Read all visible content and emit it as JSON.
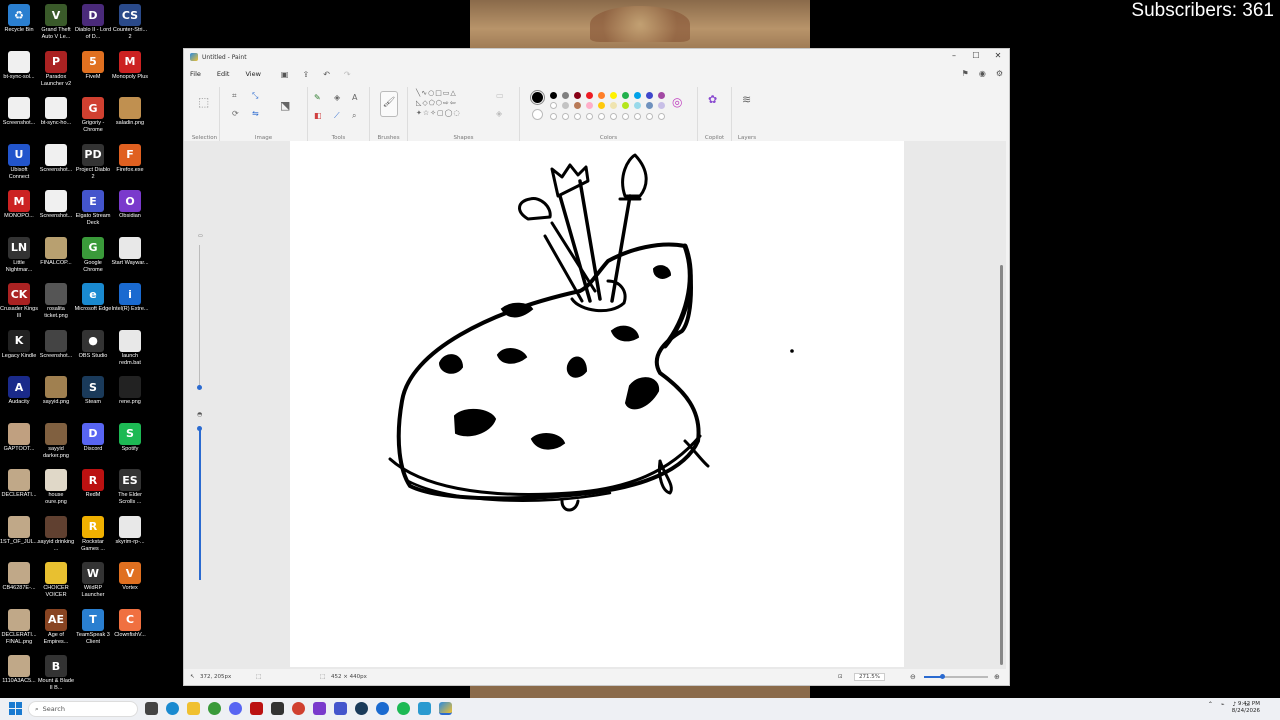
{
  "overlay": {
    "subscribers": "Subscribers: 361"
  },
  "desktop_icons": [
    {
      "label": "Recycle Bin",
      "color": "#2a7fd0",
      "glyph": "♻"
    },
    {
      "label": "Grand Theft Auto V Le...",
      "color": "#3a5a2a",
      "glyph": "V"
    },
    {
      "label": "Diablo II - Lord of D...",
      "color": "#4a2a7a",
      "glyph": "D"
    },
    {
      "label": "Counter-Stri... 2",
      "color": "#2a4a8a",
      "glyph": "CS"
    },
    {
      "label": "bt-sync-sol...",
      "color": "#f0f0f0",
      "glyph": ""
    },
    {
      "label": "Paradox Launcher v2",
      "color": "#aa2222",
      "glyph": "P"
    },
    {
      "label": "FiveM",
      "color": "#e07020",
      "glyph": "5"
    },
    {
      "label": "Monopoly Plus",
      "color": "#cc2222",
      "glyph": "M"
    },
    {
      "label": "Screenshot...",
      "color": "#f0f0f0",
      "glyph": ""
    },
    {
      "label": "bt-sync-ho...",
      "color": "#f0f0f0",
      "glyph": ""
    },
    {
      "label": "Grigoriy - Chrome",
      "color": "#d04030",
      "glyph": "G"
    },
    {
      "label": "saladin.png",
      "color": "#c09050",
      "glyph": ""
    },
    {
      "label": "Ubisoft Connect",
      "color": "#2255cc",
      "glyph": "U"
    },
    {
      "label": "Screenshot...",
      "color": "#f0f0f0",
      "glyph": ""
    },
    {
      "label": "Project Diablo 2",
      "color": "#333333",
      "glyph": "PD"
    },
    {
      "label": "Firefox.exe",
      "color": "#e06020",
      "glyph": "F"
    },
    {
      "label": "MONOPO...",
      "color": "#cc2222",
      "glyph": "M"
    },
    {
      "label": "Screenshot...",
      "color": "#f0f0f0",
      "glyph": ""
    },
    {
      "label": "Elgato Stream Deck",
      "color": "#4455cc",
      "glyph": "E"
    },
    {
      "label": "Obsidian",
      "color": "#7a3acc",
      "glyph": "O"
    },
    {
      "label": "Little Nightmar...",
      "color": "#333333",
      "glyph": "LN"
    },
    {
      "label": "FINALCOP...",
      "color": "#b8a070",
      "glyph": ""
    },
    {
      "label": "Google Chrome",
      "color": "#3a9a3a",
      "glyph": "G"
    },
    {
      "label": "Start Waywar...",
      "color": "#e8e8e8",
      "glyph": ""
    },
    {
      "label": "Crusader Kings III",
      "color": "#aa2222",
      "glyph": "CK"
    },
    {
      "label": "rosalita ticket.png",
      "color": "#555555",
      "glyph": ""
    },
    {
      "label": "Microsoft Edge",
      "color": "#1a8ad0",
      "glyph": "e"
    },
    {
      "label": "Intel(R) Extre...",
      "color": "#1a6ad0",
      "glyph": "i"
    },
    {
      "label": "Legacy Kindle",
      "color": "#222222",
      "glyph": "K"
    },
    {
      "label": "Screenshot...",
      "color": "#444444",
      "glyph": ""
    },
    {
      "label": "OBS Studio",
      "color": "#333333",
      "glyph": "●"
    },
    {
      "label": "launch redm.bat",
      "color": "#e8e8e8",
      "glyph": ""
    },
    {
      "label": "Audacity",
      "color": "#1a2a8a",
      "glyph": "A"
    },
    {
      "label": "sayyid.png",
      "color": "#a08050",
      "glyph": ""
    },
    {
      "label": "Steam",
      "color": "#1a3a5a",
      "glyph": "S"
    },
    {
      "label": "rene.png",
      "color": "#222222",
      "glyph": ""
    },
    {
      "label": "GAPTOOT...",
      "color": "#c0a080",
      "glyph": ""
    },
    {
      "label": "sayyid darker.png",
      "color": "#806040",
      "glyph": ""
    },
    {
      "label": "Discord",
      "color": "#5865f2",
      "glyph": "D"
    },
    {
      "label": "Spotify",
      "color": "#1db954",
      "glyph": "S"
    },
    {
      "label": "DECLERATI...",
      "color": "#c0a888",
      "glyph": ""
    },
    {
      "label": "house oure.png",
      "color": "#e0d8c8",
      "glyph": ""
    },
    {
      "label": "RedM",
      "color": "#bb1111",
      "glyph": "R"
    },
    {
      "label": "The Elder Scrolls ...",
      "color": "#333333",
      "glyph": "ES"
    },
    {
      "label": "1ST_OF_JUL...",
      "color": "#c0a888",
      "glyph": ""
    },
    {
      "label": "sayyid drinking ...",
      "color": "#604030",
      "glyph": ""
    },
    {
      "label": "Rockstar Games ...",
      "color": "#f0b000",
      "glyph": "R"
    },
    {
      "label": "skyrim-rp-...",
      "color": "#e8e8e8",
      "glyph": ""
    },
    {
      "label": "CB46287E-...",
      "color": "#c0a888",
      "glyph": ""
    },
    {
      "label": "CHOICER VOICER",
      "color": "#e8c030",
      "glyph": ""
    },
    {
      "label": "WildRP Launcher",
      "color": "#333333",
      "glyph": "W"
    },
    {
      "label": "Vortex",
      "color": "#e07020",
      "glyph": "V"
    },
    {
      "label": "DECLERATI... FINAL.png",
      "color": "#c0a888",
      "glyph": ""
    },
    {
      "label": "Age of Empires...",
      "color": "#884422",
      "glyph": "AE"
    },
    {
      "label": "TeamSpeak 3 Client",
      "color": "#2a7fd0",
      "glyph": "T"
    },
    {
      "label": "ClownfishV...",
      "color": "#f07040",
      "glyph": "C"
    },
    {
      "label": "1110A3AC5...",
      "color": "#c0a888",
      "glyph": ""
    },
    {
      "label": "Mount & Blade II B...",
      "color": "#333333",
      "glyph": "B"
    }
  ],
  "paint": {
    "title": "Untitled - Paint",
    "menu": [
      "File",
      "Edit",
      "View"
    ],
    "groups": [
      "Selection",
      "Image",
      "Tools",
      "Brushes",
      "Shapes",
      "Colors",
      "Copilot",
      "Layers"
    ],
    "colors_row1": [
      "#000000",
      "#7f7f7f",
      "#880015",
      "#ed1c24",
      "#ff7f27",
      "#fff200",
      "#22b14c",
      "#00a2e8",
      "#3f48cc",
      "#a349a4"
    ],
    "colors_row2": [
      "#ffffff",
      "#c3c3c3",
      "#b97a57",
      "#ffaec9",
      "#ffc90e",
      "#efe4b0",
      "#b5e61d",
      "#99d9ea",
      "#7092be",
      "#c8bfe7"
    ],
    "status": {
      "cursor_pos": "372, 205px",
      "canvas_size": "452 × 440px",
      "zoom": "271.5%"
    }
  },
  "taskbar": {
    "search_placeholder": "Search",
    "time": "9:42 PM",
    "date": "8/24/2026"
  }
}
